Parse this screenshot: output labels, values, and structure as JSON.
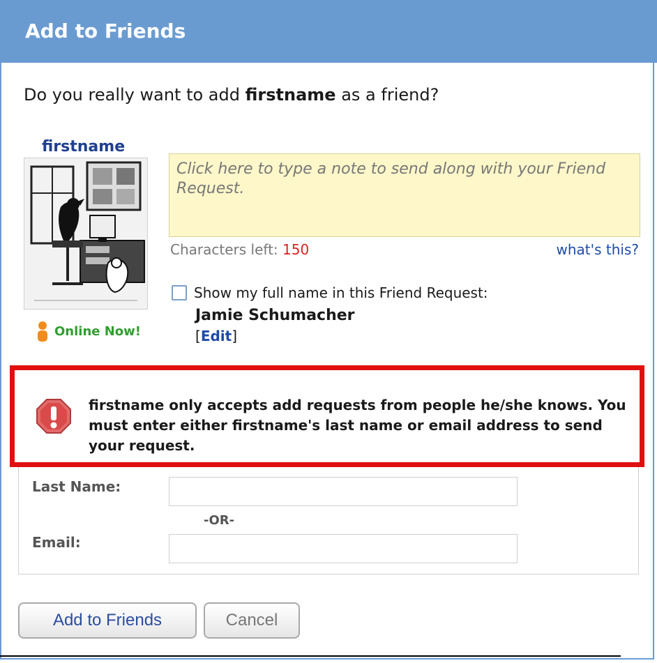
{
  "dialog": {
    "title": "Add to Friends",
    "question_prefix": "Do you really want to add ",
    "question_name": "firstname",
    "question_suffix": " as a friend?"
  },
  "profile": {
    "name": "firstname",
    "status": "Online Now!"
  },
  "note": {
    "placeholder": "Click here to type a note to send along with your Friend Request.",
    "value": "",
    "chars_left_label": "Characters left:",
    "chars_left_value": "150",
    "help_link": "what's this?"
  },
  "fullname_option": {
    "label": "Show my full name in this Friend Request:",
    "checked": false,
    "full_name": "Jamie Schumacher",
    "edit_open": "[",
    "edit_label": "Edit",
    "edit_close": "]"
  },
  "alert": {
    "message": "firstname only accepts add requests from people he/she knows. You must enter either firstname's last name or email address to send your request."
  },
  "form": {
    "last_name_label": "Last Name:",
    "last_name_value": "",
    "or_text": "-OR-",
    "email_label": "Email:",
    "email_value": ""
  },
  "buttons": {
    "add": "Add to Friends",
    "cancel": "Cancel"
  },
  "colors": {
    "titlebar": "#6a9bd0",
    "alert_border": "#e01010",
    "link": "#1e4aa8",
    "online": "#2f9e2f"
  }
}
